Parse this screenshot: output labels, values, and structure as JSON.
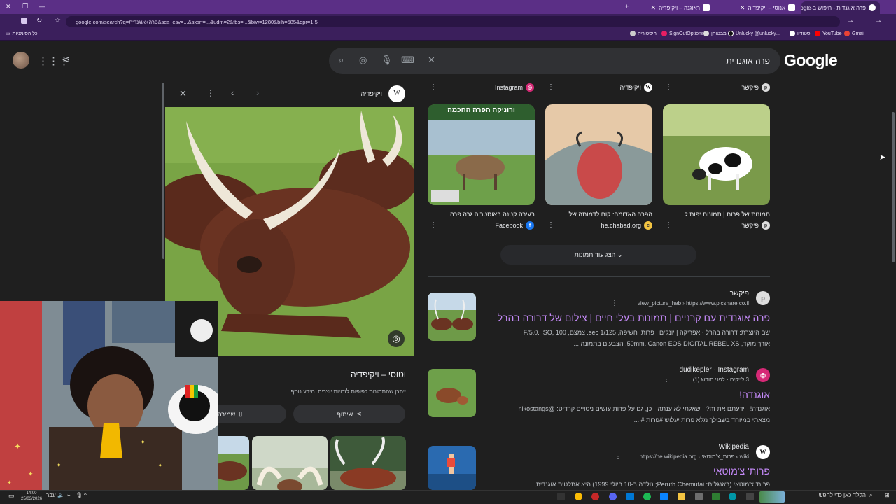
{
  "browser": {
    "tabs": [
      {
        "title": "פרה אוגנדית - חיפוש ב-Google",
        "active": true
      },
      {
        "title": "אנוסי – ויקיפדיה",
        "active": false
      },
      {
        "title": "ראוגנה – ויקיפדיה",
        "active": false
      }
    ],
    "url": "google.com/search?q=פרה+אוגנדית&sca_esv=...&sxsrf=...&udm=2&fbs=...&biw=1280&bih=585&dpr=1.5",
    "bookmarks": [
      "כל הסימניות",
      "Gmail",
      "YouTube",
      "סטודיו",
      "Unlucky @unlucky...",
      "מבטוחן",
      "SignOutOptions",
      "היסטוריה"
    ]
  },
  "header": {
    "logo": "Google",
    "query": "פרה אוגנדית"
  },
  "preview": {
    "source": "ויקיפדיה",
    "title": "וטוסי – ויקיפדיה",
    "desc": "ייתכן שהתמונות כפופות לזכויות יוצרים. מידע נוסף",
    "share": "שיתוף",
    "save": "שמירה"
  },
  "image_cards": [
    {
      "source": "פיקשר",
      "title": "תמונות של פרות | תמונות יפות ל...",
      "footer": "פיקשר",
      "colors": [
        "#7a9a4a",
        "#bcd08a"
      ]
    },
    {
      "source": "ויקיפדיה",
      "title": "הפרה האדומה: קום לדמותה של ...",
      "footer": "he.chabad.org",
      "colors": [
        "#c94a4a",
        "#e6c9a8"
      ]
    },
    {
      "source": "Instagram",
      "title": "בעירה קטנה באוסטריה גרה פרה ...",
      "footer": "Facebook",
      "caption": "ורוניקה הפרה החכמה",
      "colors": [
        "#8a6a4a",
        "#6ea04a"
      ]
    }
  ],
  "show_more": "הצג עוד תמונות",
  "results": [
    {
      "site": "פיקשר",
      "url": "view_picture_heb › https://www.picshare.co.il",
      "title": "פרה אוגנדית עם קרניים | תמונות בעלי חיים | צילום של דרורה בהרל",
      "snippet1": "שם היוצרת: דרורה בהרל · אפריקה | יונקים | פרות. חשיפה, 1/125 sec. צמצם, F/5.0. ISO, 100",
      "snippet2": "אורך מוקד, 50mm. Canon EOS DIGITAL REBEL XS. הצבעים בתמונה ..."
    },
    {
      "site": "dudikepler · Instagram",
      "url": "3 לייקים · לפני חודש (1)",
      "title": "אוגנדה!",
      "snippet1": "אוגנדה! · ידעתם את זה? · שאלתי לא ענתה · כן, גם על פרות עושים ניסויים קרדיט: @nikostangs",
      "snippet2": "מצאתי במיוחד בשבילך מלא פרות יעלוש #פרות # ..."
    },
    {
      "site": "Wikipedia",
      "url": "wiki › פרות_צ'מוטאי › https://he.wikipedia.org",
      "title": "פרות' צ'מוטאי",
      "snippet1": "פרות' צ'מוטאי (באנגלית: Peruth Chemutai; נולדה ב-10 ביולי 1999) היא אתלטית אוגנדית,",
      "snippet2": ""
    }
  ],
  "taskbar": {
    "time": "14:00",
    "date": "25/03/2026",
    "lang": "עבר",
    "search": "הקלד כאן כדי לחפש"
  }
}
